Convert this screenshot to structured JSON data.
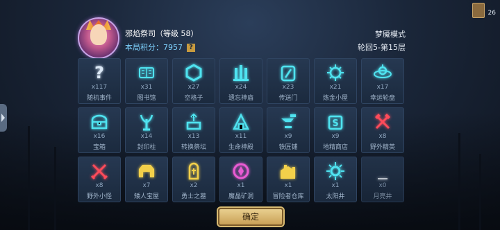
{
  "player": {
    "name": "邪焰祭司（等级 58）",
    "score_label": "本局积分：7957",
    "help": "?"
  },
  "mode": {
    "title": "梦魇模式",
    "round": "轮回5-第15层"
  },
  "corner": {
    "count": "26"
  },
  "colors": {
    "cyan": "#4fe3f0",
    "yellow": "#f3d04a",
    "red": "#ff4b5a",
    "pink": "#e95bd3",
    "white": "#e6ecf4",
    "accent": "#7fd3ff"
  },
  "locations": [
    {
      "icon": "question-icon",
      "count": "x117",
      "label": "随机事件",
      "color": "#dbe8f6"
    },
    {
      "icon": "library-icon",
      "count": "x31",
      "label": "图书馆",
      "color": "#4fe3f0"
    },
    {
      "icon": "hexagon-icon",
      "count": "x27",
      "label": "空格子",
      "color": "#4fe3f0"
    },
    {
      "icon": "temple-icon",
      "count": "x24",
      "label": "遗忘神庙",
      "color": "#4fe3f0"
    },
    {
      "icon": "portal-icon",
      "count": "x23",
      "label": "传送门",
      "color": "#4fe3f0"
    },
    {
      "icon": "alchemy-icon",
      "count": "x21",
      "label": "炼金小屋",
      "color": "#4fe3f0"
    },
    {
      "icon": "wheel-icon",
      "count": "x17",
      "label": "幸运轮盘",
      "color": "#4fe3f0"
    },
    {
      "icon": "chest-icon",
      "count": "x16",
      "label": "宝箱",
      "color": "#4fe3f0"
    },
    {
      "icon": "seal-pillar-icon",
      "count": "x14",
      "label": "封印柱",
      "color": "#4fe3f0"
    },
    {
      "icon": "altar-icon",
      "count": "x13",
      "label": "转换祭坛",
      "color": "#4fe3f0"
    },
    {
      "icon": "life-temple-icon",
      "count": "x11",
      "label": "生命神殿",
      "color": "#4fe3f0"
    },
    {
      "icon": "anvil-icon",
      "count": "x9",
      "label": "铁匠铺",
      "color": "#4fe3f0"
    },
    {
      "icon": "shop-icon",
      "count": "x9",
      "label": "地精商店",
      "color": "#4fe3f0"
    },
    {
      "icon": "crossed-axes-icon",
      "count": "x8",
      "label": "野外精英",
      "color": "#ff4b5a"
    },
    {
      "icon": "crossed-swords-icon",
      "count": "x8",
      "label": "野外小怪",
      "color": "#ff4b5a"
    },
    {
      "icon": "dwarf-house-icon",
      "count": "x7",
      "label": "矮人宝屋",
      "color": "#f3d04a"
    },
    {
      "icon": "tomb-icon",
      "count": "x2",
      "label": "勇士之墓",
      "color": "#f3d04a"
    },
    {
      "icon": "crystal-mine-icon",
      "count": "x1",
      "label": "魔晶矿洞",
      "color": "#e95bd3"
    },
    {
      "icon": "warehouse-icon",
      "count": "x1",
      "label": "冒险者仓库",
      "color": "#f3d04a"
    },
    {
      "icon": "sun-well-icon",
      "count": "x1",
      "label": "太阳井",
      "color": "#4fe3f0"
    },
    {
      "icon": "moon-altar-icon",
      "count": "x0",
      "label": "月亮井",
      "color": "#e6ecf4"
    }
  ],
  "confirm_label": "确定"
}
